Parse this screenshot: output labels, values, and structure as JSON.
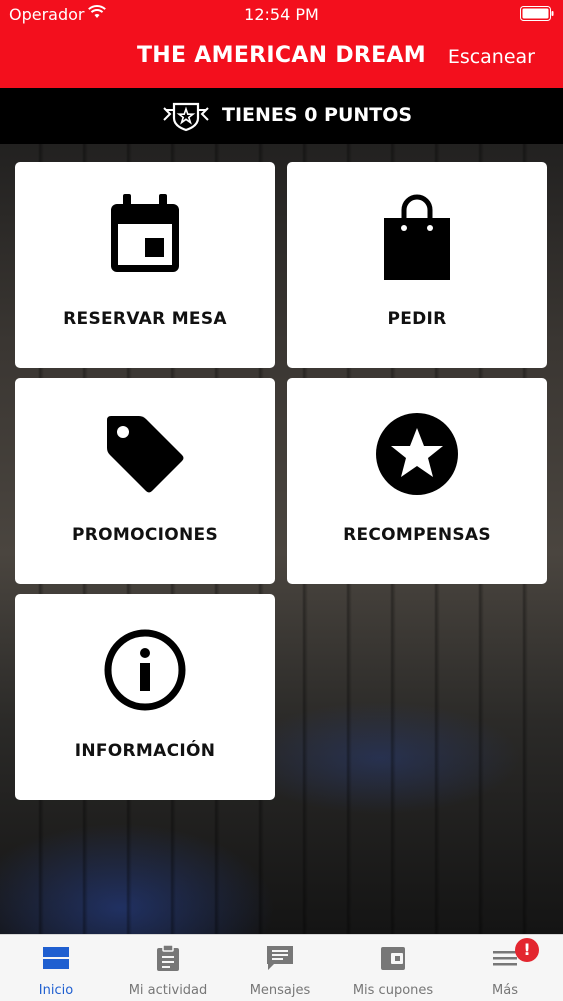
{
  "status_bar": {
    "carrier": "Operador",
    "time": "12:54 PM"
  },
  "header": {
    "title": "THE AMERICAN DREAM",
    "action": "Escanear"
  },
  "points": {
    "label": "TIENES 0 PUNTOS"
  },
  "cards": [
    {
      "label": "RESERVAR MESA",
      "icon": "calendar-icon"
    },
    {
      "label": "PEDIR",
      "icon": "shopping-bag-icon"
    },
    {
      "label": "PROMOCIONES",
      "icon": "tag-icon"
    },
    {
      "label": "RECOMPENSAS",
      "icon": "star-icon"
    },
    {
      "label": "INFORMACIÓN",
      "icon": "info-icon"
    }
  ],
  "tabs": [
    {
      "label": "Inicio",
      "icon": "home-icon",
      "active": true
    },
    {
      "label": "Mi actividad",
      "icon": "clipboard-icon"
    },
    {
      "label": "Mensajes",
      "icon": "message-icon"
    },
    {
      "label": "Mis cupones",
      "icon": "wallet-icon"
    },
    {
      "label": "Más",
      "icon": "menu-icon"
    }
  ],
  "notification_badge": "!",
  "colors": {
    "brand_red": "#f30f1d",
    "tab_active": "#1f5fd0",
    "badge_red": "#e3262f"
  }
}
